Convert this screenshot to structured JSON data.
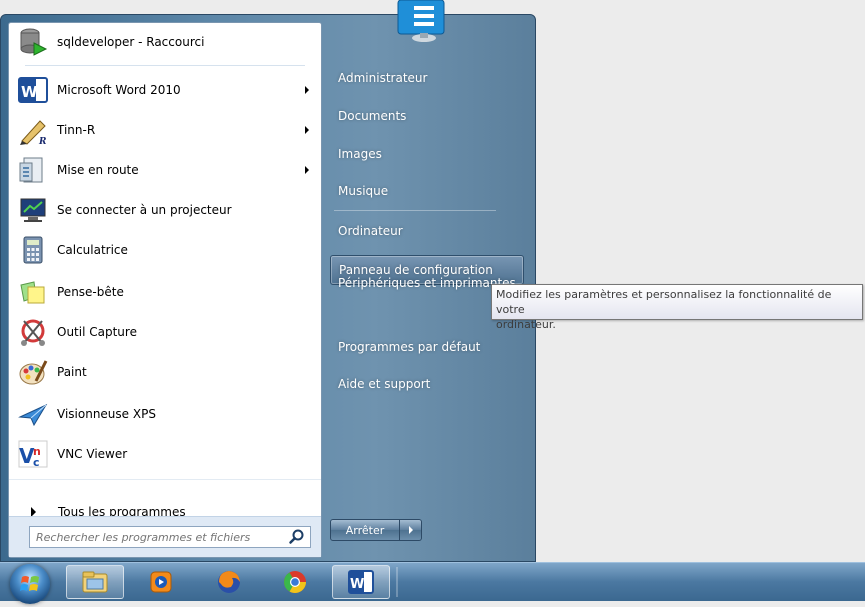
{
  "start_menu": {
    "programs": [
      {
        "label": "sqldeveloper - Raccourci",
        "icon": "sqldeveloper-icon",
        "has_submenu": false
      },
      {
        "label": "Microsoft Word 2010",
        "icon": "word-icon",
        "has_submenu": true
      },
      {
        "label": "Tinn-R",
        "icon": "tinn-r-icon",
        "has_submenu": true
      },
      {
        "label": "Mise en route",
        "icon": "getting-started-icon",
        "has_submenu": true
      },
      {
        "label": "Se connecter à un projecteur",
        "icon": "projector-icon",
        "has_submenu": false
      },
      {
        "label": "Calculatrice",
        "icon": "calculator-icon",
        "has_submenu": false
      },
      {
        "label": "Pense-bête",
        "icon": "sticky-notes-icon",
        "has_submenu": false
      },
      {
        "label": "Outil Capture",
        "icon": "snipping-tool-icon",
        "has_submenu": false
      },
      {
        "label": "Paint",
        "icon": "paint-icon",
        "has_submenu": false
      },
      {
        "label": "Visionneuse XPS",
        "icon": "xps-viewer-icon",
        "has_submenu": false
      },
      {
        "label": "VNC Viewer",
        "icon": "vnc-viewer-icon",
        "has_submenu": false
      }
    ],
    "all_programs_label": "Tous les programmes",
    "search_placeholder": "Rechercher les programmes et fichiers",
    "right_items": [
      {
        "label": "Administrateur"
      },
      {
        "label": "Documents"
      },
      {
        "label": "Images"
      },
      {
        "label": "Musique"
      },
      {
        "label": "Ordinateur"
      },
      {
        "label": "Panneau de configuration",
        "highlighted": true
      },
      {
        "label": "Périphériques et imprimantes"
      },
      {
        "label": "Programmes par défaut"
      },
      {
        "label": "Aide et support"
      }
    ],
    "shutdown_label": "Arrêter"
  },
  "tooltip": {
    "line1": "Modifiez les paramètres et personnalisez la fonctionnalité de votre",
    "line2": "ordinateur."
  },
  "taskbar": {
    "buttons": [
      {
        "icon": "start-orb-icon"
      },
      {
        "icon": "explorer-icon",
        "active": true
      },
      {
        "icon": "media-player-icon"
      },
      {
        "icon": "firefox-icon"
      },
      {
        "icon": "chrome-icon"
      },
      {
        "icon": "word-taskbar-icon",
        "active": true
      }
    ]
  },
  "colors": {
    "frame": "#5d87a8",
    "tooltip_border": "#767676",
    "taskbar": "#4b78a1"
  }
}
